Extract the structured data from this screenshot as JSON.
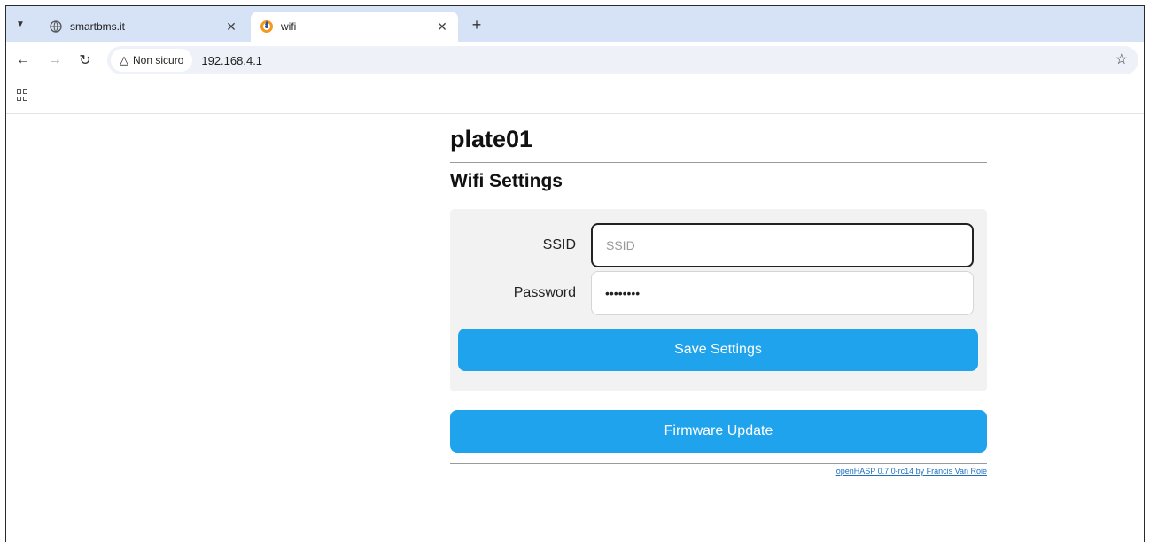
{
  "browser": {
    "tabs": [
      {
        "title": "smartbms.it",
        "active": false
      },
      {
        "title": "wifi",
        "active": true
      }
    ],
    "address": {
      "security_label": "Non sicuro",
      "url": "192.168.4.1"
    }
  },
  "page": {
    "hostname": "plate01",
    "section_title": "Wifi Settings",
    "form": {
      "ssid_label": "SSID",
      "ssid_placeholder": "SSID",
      "password_label": "Password",
      "password_value": "••••••••",
      "save_label": "Save Settings"
    },
    "firmware_label": "Firmware Update",
    "footer_text": "openHASP 0.7.0-rc14 by Francis Van Roie"
  },
  "colors": {
    "accent": "#1fa3ec",
    "tabstrip": "#d6e2f6"
  }
}
